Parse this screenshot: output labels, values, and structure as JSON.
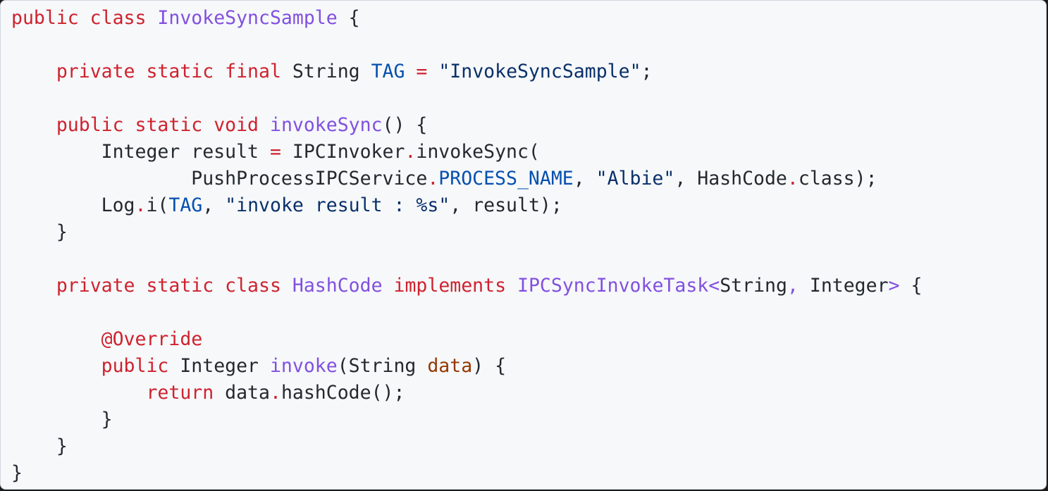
{
  "colors": {
    "background": "#f6f8fa",
    "border": "#d0d7de",
    "keyword": "#cf222e",
    "class_name": "#8250df",
    "method_name": "#8250df",
    "constant": "#0550ae",
    "string": "#0a3069",
    "parameter": "#953800",
    "plain": "#24292f"
  },
  "code": {
    "language": "java",
    "lines": [
      [
        {
          "t": "public class ",
          "k": "keyword"
        },
        {
          "t": "InvokeSyncSample",
          "k": "class_name"
        },
        {
          "t": " {",
          "k": "plain"
        }
      ],
      [],
      [
        {
          "t": "    ",
          "k": "plain"
        },
        {
          "t": "private static final",
          "k": "keyword"
        },
        {
          "t": " String ",
          "k": "plain"
        },
        {
          "t": "TAG",
          "k": "constant"
        },
        {
          "t": " ",
          "k": "plain"
        },
        {
          "t": "=",
          "k": "keyword"
        },
        {
          "t": " ",
          "k": "plain"
        },
        {
          "t": "\"InvokeSyncSample\"",
          "k": "string"
        },
        {
          "t": ";",
          "k": "plain"
        }
      ],
      [],
      [
        {
          "t": "    ",
          "k": "plain"
        },
        {
          "t": "public static void",
          "k": "keyword"
        },
        {
          "t": " ",
          "k": "plain"
        },
        {
          "t": "invokeSync",
          "k": "method_name"
        },
        {
          "t": "() {",
          "k": "plain"
        }
      ],
      [
        {
          "t": "        Integer result ",
          "k": "plain"
        },
        {
          "t": "=",
          "k": "keyword"
        },
        {
          "t": " IPCInvoker",
          "k": "plain"
        },
        {
          "t": ".",
          "k": "keyword"
        },
        {
          "t": "invokeSync(",
          "k": "plain"
        }
      ],
      [
        {
          "t": "                PushProcessIPCService",
          "k": "plain"
        },
        {
          "t": ".",
          "k": "keyword"
        },
        {
          "t": "PROCESS_NAME",
          "k": "constant"
        },
        {
          "t": ", ",
          "k": "plain"
        },
        {
          "t": "\"Albie\"",
          "k": "string"
        },
        {
          "t": ", HashCode",
          "k": "plain"
        },
        {
          "t": ".",
          "k": "keyword"
        },
        {
          "t": "class);",
          "k": "plain"
        }
      ],
      [
        {
          "t": "        Log",
          "k": "plain"
        },
        {
          "t": ".",
          "k": "keyword"
        },
        {
          "t": "i(",
          "k": "plain"
        },
        {
          "t": "TAG",
          "k": "constant"
        },
        {
          "t": ", ",
          "k": "plain"
        },
        {
          "t": "\"invoke result : %s\"",
          "k": "string"
        },
        {
          "t": ", result);",
          "k": "plain"
        }
      ],
      [
        {
          "t": "    }",
          "k": "plain"
        }
      ],
      [],
      [
        {
          "t": "    ",
          "k": "plain"
        },
        {
          "t": "private static class",
          "k": "keyword"
        },
        {
          "t": " ",
          "k": "plain"
        },
        {
          "t": "HashCode",
          "k": "class_name"
        },
        {
          "t": " ",
          "k": "plain"
        },
        {
          "t": "implements",
          "k": "keyword"
        },
        {
          "t": " ",
          "k": "plain"
        },
        {
          "t": "IPCSyncInvokeTask<",
          "k": "class_name"
        },
        {
          "t": "String",
          "k": "plain"
        },
        {
          "t": ",",
          "k": "class_name"
        },
        {
          "t": " Integer",
          "k": "plain"
        },
        {
          "t": ">",
          "k": "class_name"
        },
        {
          "t": " {",
          "k": "plain"
        }
      ],
      [],
      [
        {
          "t": "        ",
          "k": "plain"
        },
        {
          "t": "@Override",
          "k": "keyword"
        }
      ],
      [
        {
          "t": "        ",
          "k": "plain"
        },
        {
          "t": "public",
          "k": "keyword"
        },
        {
          "t": " Integer ",
          "k": "plain"
        },
        {
          "t": "invoke",
          "k": "method_name"
        },
        {
          "t": "(String ",
          "k": "plain"
        },
        {
          "t": "data",
          "k": "parameter"
        },
        {
          "t": ") {",
          "k": "plain"
        }
      ],
      [
        {
          "t": "            ",
          "k": "plain"
        },
        {
          "t": "return",
          "k": "keyword"
        },
        {
          "t": " data",
          "k": "plain"
        },
        {
          "t": ".",
          "k": "keyword"
        },
        {
          "t": "hashCode();",
          "k": "plain"
        }
      ],
      [
        {
          "t": "        }",
          "k": "plain"
        }
      ],
      [
        {
          "t": "    }",
          "k": "plain"
        }
      ],
      [
        {
          "t": "}",
          "k": "plain"
        }
      ]
    ]
  }
}
